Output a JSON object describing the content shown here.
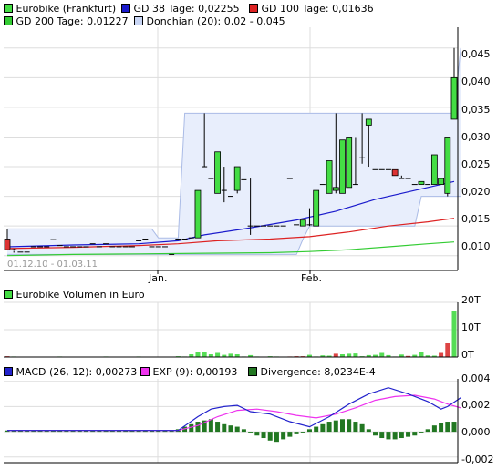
{
  "colors": {
    "candle_up": "#44dd44",
    "candle_down": "#dd3333",
    "gd38": "#1a1acc",
    "gd100": "#dd2222",
    "gd200": "#33cc33",
    "donchian_fill": "#e8eefc",
    "donchian_line": "#aabbe6",
    "macd": "#2222cc",
    "exp": "#ee33ee",
    "divergence": "#227722",
    "volume_up": "#55dd55",
    "volume_down": "#dd4444",
    "grid": "#dddddd"
  },
  "price_panel": {
    "legend": [
      {
        "label": "Eurobike (Frankfurt)",
        "color": "#44dd44",
        "icon": "candle-swatch-icon"
      },
      {
        "label": "GD 38 Tage: 0,02255",
        "color": "#1a1acc",
        "icon": "line-swatch-icon"
      },
      {
        "label": "GD 100 Tage: 0,01636",
        "color": "#dd2222",
        "icon": "line-swatch-icon"
      },
      {
        "label": "GD 200 Tage: 0,01227",
        "color": "#33cc33",
        "icon": "line-swatch-icon"
      },
      {
        "label": "Donchian (20): 0,02 - 0,045",
        "color": "#aabbe6",
        "icon": "band-swatch-icon"
      }
    ],
    "date_range_label": "01.12.10 - 01.03.11",
    "x_tick_labels": [
      "Jan.",
      "Feb."
    ],
    "y_tick_labels": [
      "0,045",
      "0,040",
      "0,035",
      "0,030",
      "0,025",
      "0,020",
      "0,015",
      "0,010"
    ]
  },
  "volume_panel": {
    "legend": [
      {
        "label": "Eurobike Volumen in Euro",
        "color": "#44dd44",
        "icon": "bar-swatch-icon"
      }
    ],
    "y_tick_labels": [
      "20T",
      "10T",
      "0T"
    ]
  },
  "macd_panel": {
    "legend": [
      {
        "label": "MACD (26, 12): 0,00273",
        "color": "#2222cc",
        "icon": "line-swatch-icon"
      },
      {
        "label": "EXP (9): 0,00193",
        "color": "#ee33ee",
        "icon": "line-swatch-icon"
      },
      {
        "label": "Divergence: 8,0234E-4",
        "color": "#227722",
        "icon": "bar-swatch-icon"
      }
    ],
    "y_tick_labels": [
      "0,004",
      "0,002",
      "0,000",
      "-0,002"
    ]
  },
  "chart_data": [
    {
      "type": "candlestick",
      "title": "Eurobike (Frankfurt)",
      "x_range": [
        "2010-12-01",
        "2011-03-01"
      ],
      "ylim": [
        0.0075,
        0.0485
      ],
      "candles": [
        {
          "o": 0.0128,
          "h": 0.0145,
          "l": 0.011,
          "c": 0.011,
          "d": "down"
        },
        {
          "o": 0.011,
          "h": 0.0112,
          "l": 0.0105,
          "c": 0.0108
        },
        {
          "o": 0.0106,
          "h": 0.0106,
          "l": 0.0106,
          "c": 0.0106
        },
        {
          "o": 0.0106,
          "h": 0.0106,
          "l": 0.0106,
          "c": 0.0106
        },
        {
          "o": 0.0115,
          "h": 0.0115,
          "l": 0.0115,
          "c": 0.0115
        },
        {
          "o": 0.0115,
          "h": 0.0115,
          "l": 0.0115,
          "c": 0.0115
        },
        {
          "o": 0.0115,
          "h": 0.0115,
          "l": 0.0115,
          "c": 0.0115
        },
        {
          "o": 0.0127,
          "h": 0.0127,
          "l": 0.0127,
          "c": 0.0127
        },
        {
          "o": 0.0117,
          "h": 0.0117,
          "l": 0.0117,
          "c": 0.0117
        },
        {
          "o": 0.0115,
          "h": 0.0115,
          "l": 0.0115,
          "c": 0.0115
        },
        {
          "o": 0.0115,
          "h": 0.0115,
          "l": 0.0115,
          "c": 0.0115
        },
        {
          "o": 0.0115,
          "h": 0.0115,
          "l": 0.0115,
          "c": 0.0115
        },
        {
          "o": 0.0115,
          "h": 0.0115,
          "l": 0.0115,
          "c": 0.0115
        },
        {
          "o": 0.012,
          "h": 0.012,
          "l": 0.012,
          "c": 0.012
        },
        {
          "o": 0.0115,
          "h": 0.0115,
          "l": 0.0115,
          "c": 0.0115
        },
        {
          "o": 0.012,
          "h": 0.012,
          "l": 0.012,
          "c": 0.012
        },
        {
          "o": 0.0115,
          "h": 0.0115,
          "l": 0.0115,
          "c": 0.0115
        },
        {
          "o": 0.0115,
          "h": 0.0115,
          "l": 0.0115,
          "c": 0.0115
        },
        {
          "o": 0.0115,
          "h": 0.0115,
          "l": 0.0115,
          "c": 0.0115
        },
        {
          "o": 0.0115,
          "h": 0.0115,
          "l": 0.0115,
          "c": 0.0115
        },
        {
          "o": 0.0125,
          "h": 0.0125,
          "l": 0.0125,
          "c": 0.0125
        },
        {
          "o": 0.0128,
          "h": 0.0128,
          "l": 0.0128,
          "c": 0.0128
        },
        {
          "o": 0.0115,
          "h": 0.0115,
          "l": 0.0115,
          "c": 0.0115
        },
        {
          "o": 0.0115,
          "h": 0.0115,
          "l": 0.0115,
          "c": 0.0115
        },
        {
          "o": 0.0115,
          "h": 0.0115,
          "l": 0.0115,
          "c": 0.0115
        },
        {
          "o": 0.0102,
          "h": 0.0102,
          "l": 0.0102,
          "c": 0.0102
        },
        {
          "o": 0.0128,
          "h": 0.0128,
          "l": 0.0128,
          "c": 0.0128
        },
        {
          "o": 0.0128,
          "h": 0.0128,
          "l": 0.0128,
          "c": 0.0128
        },
        {
          "o": 0.013,
          "h": 0.013,
          "l": 0.013,
          "c": 0.013
        },
        {
          "o": 0.013,
          "h": 0.021,
          "l": 0.013,
          "c": 0.021
        },
        {
          "o": 0.025,
          "h": 0.034,
          "l": 0.025,
          "c": 0.025
        },
        {
          "o": 0.023,
          "h": 0.023,
          "l": 0.023,
          "c": 0.023
        },
        {
          "o": 0.0205,
          "h": 0.0275,
          "l": 0.0205,
          "c": 0.0275
        },
        {
          "o": 0.021,
          "h": 0.025,
          "l": 0.019,
          "c": 0.021
        },
        {
          "o": 0.02,
          "h": 0.02,
          "l": 0.02,
          "c": 0.02
        },
        {
          "o": 0.021,
          "h": 0.025,
          "l": 0.0205,
          "c": 0.025
        },
        {
          "o": 0.0228,
          "h": 0.0228,
          "l": 0.0228,
          "c": 0.0228
        },
        {
          "o": 0.015,
          "h": 0.023,
          "l": 0.0135,
          "c": 0.015
        },
        {
          "o": 0.015,
          "h": 0.015,
          "l": 0.015,
          "c": 0.015
        },
        {
          "o": 0.015,
          "h": 0.015,
          "l": 0.015,
          "c": 0.015
        },
        {
          "o": 0.015,
          "h": 0.015,
          "l": 0.015,
          "c": 0.015
        },
        {
          "o": 0.015,
          "h": 0.015,
          "l": 0.015,
          "c": 0.015
        },
        {
          "o": 0.015,
          "h": 0.015,
          "l": 0.015,
          "c": 0.015
        },
        {
          "o": 0.023,
          "h": 0.023,
          "l": 0.023,
          "c": 0.023
        },
        {
          "o": 0.0152,
          "h": 0.0152,
          "l": 0.0152,
          "c": 0.0152
        },
        {
          "o": 0.015,
          "h": 0.016,
          "l": 0.015,
          "c": 0.016
        },
        {
          "o": 0.0152,
          "h": 0.018,
          "l": 0.015,
          "c": 0.0152
        },
        {
          "o": 0.015,
          "h": 0.021,
          "l": 0.015,
          "c": 0.021
        },
        {
          "o": 0.022,
          "h": 0.022,
          "l": 0.022,
          "c": 0.022
        },
        {
          "o": 0.0205,
          "h": 0.026,
          "l": 0.0205,
          "c": 0.026
        },
        {
          "o": 0.0215,
          "h": 0.034,
          "l": 0.0205,
          "c": 0.021
        },
        {
          "o": 0.0205,
          "h": 0.0295,
          "l": 0.0205,
          "c": 0.0295
        },
        {
          "o": 0.0215,
          "h": 0.03,
          "l": 0.0215,
          "c": 0.03
        },
        {
          "o": 0.022,
          "h": 0.03,
          "l": 0.022,
          "c": 0.022
        },
        {
          "o": 0.0265,
          "h": 0.034,
          "l": 0.0255,
          "c": 0.0265
        },
        {
          "o": 0.032,
          "h": 0.033,
          "l": 0.025,
          "c": 0.033
        },
        {
          "o": 0.0245,
          "h": 0.0245,
          "l": 0.0245,
          "c": 0.0245
        },
        {
          "o": 0.0245,
          "h": 0.0245,
          "l": 0.0245,
          "c": 0.0245
        },
        {
          "o": 0.0245,
          "h": 0.0245,
          "l": 0.0245,
          "c": 0.0245
        },
        {
          "o": 0.0245,
          "h": 0.0245,
          "l": 0.0235,
          "c": 0.0235,
          "d": "down"
        },
        {
          "o": 0.023,
          "h": 0.0235,
          "l": 0.023,
          "c": 0.023
        },
        {
          "o": 0.023,
          "h": 0.023,
          "l": 0.023,
          "c": 0.023
        },
        {
          "o": 0.022,
          "h": 0.022,
          "l": 0.022,
          "c": 0.022
        },
        {
          "o": 0.022,
          "h": 0.0225,
          "l": 0.022,
          "c": 0.0225
        },
        {
          "o": 0.022,
          "h": 0.022,
          "l": 0.022,
          "c": 0.022
        },
        {
          "o": 0.022,
          "h": 0.027,
          "l": 0.022,
          "c": 0.027
        },
        {
          "o": 0.022,
          "h": 0.023,
          "l": 0.022,
          "c": 0.023
        },
        {
          "o": 0.0205,
          "h": 0.03,
          "l": 0.02,
          "c": 0.03
        },
        {
          "o": 0.033,
          "h": 0.045,
          "l": 0.033,
          "c": 0.04
        }
      ],
      "gd38": [
        [
          0,
          0.0115
        ],
        [
          10,
          0.0118
        ],
        [
          20,
          0.012
        ],
        [
          26,
          0.0125
        ],
        [
          30,
          0.0135
        ],
        [
          36,
          0.0145
        ],
        [
          44,
          0.016
        ],
        [
          50,
          0.0175
        ],
        [
          56,
          0.0195
        ],
        [
          62,
          0.021
        ],
        [
          68,
          0.0225
        ]
      ],
      "gd100": [
        [
          0,
          0.0112
        ],
        [
          10,
          0.0114
        ],
        [
          20,
          0.0117
        ],
        [
          26,
          0.012
        ],
        [
          32,
          0.0125
        ],
        [
          40,
          0.0128
        ],
        [
          46,
          0.0132
        ],
        [
          52,
          0.014
        ],
        [
          58,
          0.015
        ],
        [
          64,
          0.0157
        ],
        [
          68,
          0.0163
        ]
      ],
      "gd200": [
        [
          0,
          0.01
        ],
        [
          10,
          0.0102
        ],
        [
          20,
          0.0103
        ],
        [
          30,
          0.0104
        ],
        [
          40,
          0.0105
        ],
        [
          46,
          0.0107
        ],
        [
          52,
          0.011
        ],
        [
          58,
          0.0115
        ],
        [
          64,
          0.012
        ],
        [
          68,
          0.0123
        ]
      ],
      "donchian_high": [
        [
          0,
          0.0145
        ],
        [
          22,
          0.0145
        ],
        [
          23,
          0.013
        ],
        [
          26,
          0.013
        ],
        [
          27,
          0.034
        ],
        [
          68,
          0.034
        ],
        [
          69,
          0.045
        ]
      ],
      "donchian_low": [
        [
          0,
          0.0102
        ],
        [
          44,
          0.0102
        ],
        [
          45,
          0.0128
        ],
        [
          46,
          0.015
        ],
        [
          62,
          0.015
        ],
        [
          63,
          0.02
        ],
        [
          69,
          0.02
        ]
      ]
    },
    {
      "type": "bar",
      "title": "Eurobike Volumen in Euro",
      "ylim": [
        0,
        20000
      ],
      "values": [
        300,
        200,
        100,
        150,
        100,
        120,
        100,
        100,
        200,
        100,
        150,
        100,
        100,
        150,
        150,
        200,
        100,
        100,
        100,
        100,
        200,
        100,
        150,
        100,
        100,
        100,
        300,
        200,
        1000,
        1800,
        2000,
        1000,
        1500,
        800,
        1200,
        1000,
        200,
        700,
        200,
        100,
        300,
        200,
        100,
        200,
        300,
        300,
        800,
        200,
        600,
        500,
        1200,
        1000,
        1200,
        1300,
        300,
        700,
        800,
        1500,
        700,
        200,
        900,
        400,
        800,
        1800,
        600,
        500,
        1500,
        5000,
        17000
      ],
      "down_indices": [
        0,
        22,
        43,
        44,
        45,
        50,
        61,
        66,
        67
      ]
    },
    {
      "type": "bar-line",
      "title": "MACD (26, 12)",
      "ylim": [
        -0.00245,
        0.0042
      ],
      "macd": [
        [
          0,
          0.0001
        ],
        [
          10,
          0.0001
        ],
        [
          20,
          0.0001
        ],
        [
          26,
          0.0001
        ],
        [
          29,
          0.0012
        ],
        [
          31,
          0.0018
        ],
        [
          33,
          0.002
        ],
        [
          35,
          0.0021
        ],
        [
          37,
          0.0016
        ],
        [
          40,
          0.0014
        ],
        [
          43,
          0.0008
        ],
        [
          46,
          0.0004
        ],
        [
          49,
          0.0012
        ],
        [
          52,
          0.0022
        ],
        [
          55,
          0.003
        ],
        [
          58,
          0.0035
        ],
        [
          61,
          0.003
        ],
        [
          64,
          0.0024
        ],
        [
          66,
          0.0018
        ],
        [
          67,
          0.002
        ],
        [
          69,
          0.0027
        ]
      ],
      "exp": [
        [
          0,
          0.0001
        ],
        [
          26,
          0.0001
        ],
        [
          29,
          0.0005
        ],
        [
          32,
          0.0012
        ],
        [
          35,
          0.0017
        ],
        [
          38,
          0.0018
        ],
        [
          41,
          0.0016
        ],
        [
          44,
          0.0013
        ],
        [
          47,
          0.0011
        ],
        [
          50,
          0.0014
        ],
        [
          53,
          0.0019
        ],
        [
          56,
          0.0025
        ],
        [
          59,
          0.0028
        ],
        [
          62,
          0.0029
        ],
        [
          65,
          0.0026
        ],
        [
          67,
          0.0022
        ],
        [
          69,
          0.0019
        ]
      ],
      "divergence": [
        0.0001,
        0.0001,
        0.0001,
        0.0001,
        0.0001,
        0.0001,
        0.0001,
        0.0001,
        0.0001,
        0.0001,
        0.0001,
        0.0001,
        0.0001,
        0.0001,
        0.0001,
        0.0001,
        0.0001,
        0.0001,
        0.0001,
        0.0001,
        0.0001,
        0.0001,
        0.0001,
        0.0001,
        0.0001,
        0.0001,
        0.0002,
        0.0004,
        0.0006,
        0.0008,
        0.0009,
        0.001,
        0.0008,
        0.0006,
        0.0005,
        0.0004,
        0.0002,
        0.0,
        -0.0003,
        -0.0005,
        -0.0007,
        -0.0008,
        -0.0006,
        -0.0004,
        -0.0002,
        0.0,
        0.0002,
        0.0004,
        0.0006,
        0.0008,
        0.0009,
        0.001,
        0.001,
        0.0008,
        0.0006,
        0.0002,
        -0.0003,
        -0.0005,
        -0.0006,
        -0.0006,
        -0.0005,
        -0.0004,
        -0.0003,
        -0.0001,
        0.0002,
        0.0005,
        0.0007,
        0.0008,
        0.0008
      ]
    }
  ]
}
